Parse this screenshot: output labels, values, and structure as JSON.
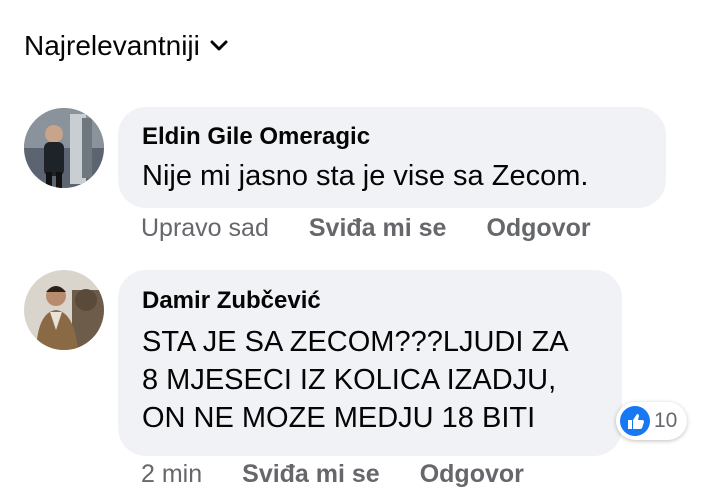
{
  "sort": {
    "label": "Najrelevantniji",
    "icon": "chevron-down-icon"
  },
  "comments": [
    {
      "author": "Eldin Gile Omeragic",
      "text": "Nije mi jasno sta je vise sa Zecom.",
      "time": "Upravo sad",
      "like_label": "Sviđa mi se",
      "reply_label": "Odgovor"
    },
    {
      "author": "Damir Zubčević",
      "text_lines": [
        "STA JE SA ZECOM???LJUDI ZA",
        "8 MJESECI IZ KOLICA IZADJU,",
        "ON NE MOZE MEDJU 18 BITI"
      ],
      "time": "2 min",
      "like_label": "Sviđa mi se",
      "reply_label": "Odgovor",
      "reaction_count": "10",
      "reaction_icon": "like-icon"
    }
  ],
  "colors": {
    "bubble": "#f0f2f5",
    "secondary_text": "#65676b",
    "like_blue": "#1877f2"
  }
}
